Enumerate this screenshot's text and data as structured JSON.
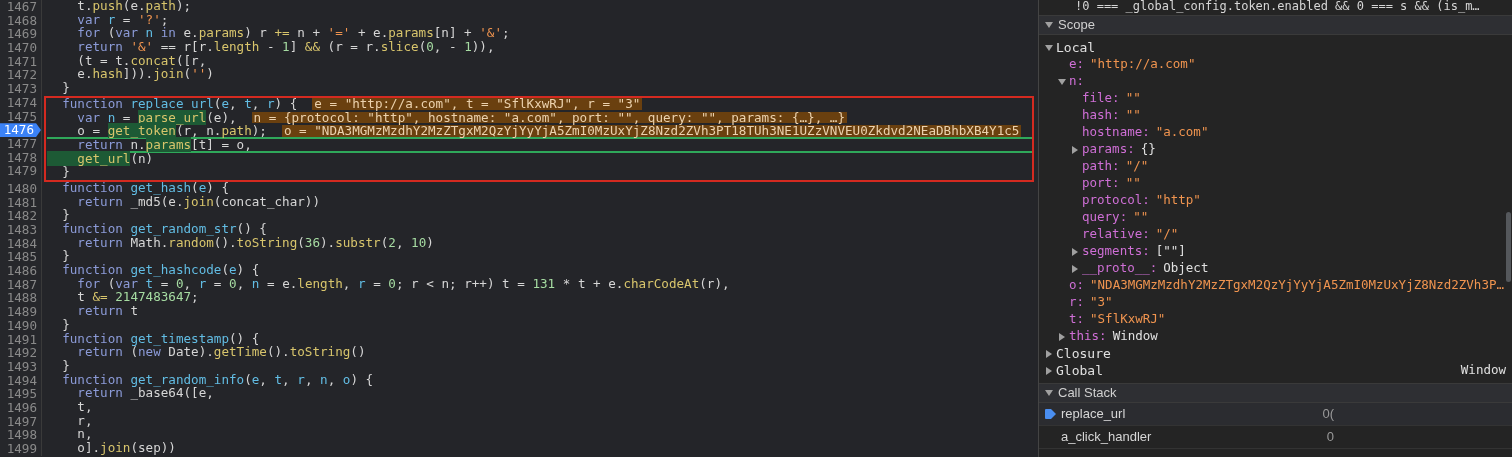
{
  "code": {
    "lines": [
      {
        "number": "1467",
        "current": false,
        "boxed": false,
        "underlined": false,
        "tokens": [
          {
            "text": "    t.",
            "kind": "plain"
          },
          {
            "text": "push",
            "kind": "prop"
          },
          {
            "text": "(e.",
            "kind": "plain"
          },
          {
            "text": "path",
            "kind": "prop"
          },
          {
            "text": ");",
            "kind": "plain"
          }
        ]
      },
      {
        "number": "1468",
        "current": false,
        "boxed": false,
        "underlined": false,
        "tokens": [
          {
            "text": "    var",
            "kind": "kw"
          },
          {
            "text": " r",
            "kind": "id"
          },
          {
            "text": " = ",
            "kind": "plain"
          },
          {
            "text": "'?'",
            "kind": "str"
          },
          {
            "text": ";",
            "kind": "plain"
          }
        ]
      },
      {
        "number": "1469",
        "current": false,
        "boxed": false,
        "underlined": false,
        "tokens": [
          {
            "text": "    for",
            "kind": "kw"
          },
          {
            "text": " (",
            "kind": "plain"
          },
          {
            "text": "var",
            "kind": "kw"
          },
          {
            "text": " n ",
            "kind": "id"
          },
          {
            "text": "in",
            "kind": "kw"
          },
          {
            "text": " e.",
            "kind": "plain"
          },
          {
            "text": "params",
            "kind": "prop"
          },
          {
            "text": ") r ",
            "kind": "plain"
          },
          {
            "text": "+=",
            "kind": "prop"
          },
          {
            "text": " n + ",
            "kind": "plain"
          },
          {
            "text": "'='",
            "kind": "str"
          },
          {
            "text": " + e.",
            "kind": "plain"
          },
          {
            "text": "params",
            "kind": "prop"
          },
          {
            "text": "[n] + ",
            "kind": "plain"
          },
          {
            "text": "'&'",
            "kind": "str"
          },
          {
            "text": ";",
            "kind": "plain"
          }
        ]
      },
      {
        "number": "1470",
        "current": false,
        "boxed": false,
        "underlined": false,
        "tokens": [
          {
            "text": "    return",
            "kind": "kw"
          },
          {
            "text": " '&'",
            "kind": "str"
          },
          {
            "text": " == r[r.",
            "kind": "plain"
          },
          {
            "text": "length",
            "kind": "prop"
          },
          {
            "text": " - ",
            "kind": "plain"
          },
          {
            "text": "1",
            "kind": "num"
          },
          {
            "text": "] ",
            "kind": "plain"
          },
          {
            "text": "&&",
            "kind": "prop"
          },
          {
            "text": " (r = r.",
            "kind": "plain"
          },
          {
            "text": "slice",
            "kind": "prop"
          },
          {
            "text": "(",
            "kind": "plain"
          },
          {
            "text": "0",
            "kind": "num"
          },
          {
            "text": ", - ",
            "kind": "plain"
          },
          {
            "text": "1",
            "kind": "num"
          },
          {
            "text": ")),",
            "kind": "plain"
          }
        ]
      },
      {
        "number": "1471",
        "current": false,
        "boxed": false,
        "underlined": false,
        "tokens": [
          {
            "text": "    (t = t.",
            "kind": "plain"
          },
          {
            "text": "concat",
            "kind": "prop"
          },
          {
            "text": "([r,",
            "kind": "plain"
          }
        ]
      },
      {
        "number": "1472",
        "current": false,
        "boxed": false,
        "underlined": false,
        "tokens": [
          {
            "text": "    e.",
            "kind": "plain"
          },
          {
            "text": "hash",
            "kind": "prop"
          },
          {
            "text": "])).",
            "kind": "plain"
          },
          {
            "text": "join",
            "kind": "prop"
          },
          {
            "text": "(",
            "kind": "plain"
          },
          {
            "text": "''",
            "kind": "str"
          },
          {
            "text": ")",
            "kind": "plain"
          }
        ]
      },
      {
        "number": "1473",
        "current": false,
        "boxed": false,
        "underlined": false,
        "tokens": [
          {
            "text": "  }",
            "kind": "plain"
          }
        ]
      },
      {
        "number": "1474",
        "current": false,
        "boxed": true,
        "underlined": false,
        "inline_value": "e = \"http://a.com\", t = \"SflKxwRJ\", r = \"3\"",
        "tokens": [
          {
            "text": "  function",
            "kind": "kw"
          },
          {
            "text": " replace_url",
            "kind": "fn"
          },
          {
            "text": "(",
            "kind": "plain"
          },
          {
            "text": "e",
            "kind": "id"
          },
          {
            "text": ", ",
            "kind": "plain"
          },
          {
            "text": "t",
            "kind": "id"
          },
          {
            "text": ", ",
            "kind": "plain"
          },
          {
            "text": "r",
            "kind": "id"
          },
          {
            "text": ") {",
            "kind": "plain"
          }
        ]
      },
      {
        "number": "1475",
        "current": false,
        "boxed": true,
        "underlined": false,
        "inline_value": "n = {protocol: \"http\", hostname: \"a.com\", port: \"\", query: \"\", params: {…}, …}",
        "tokens": [
          {
            "text": "    var",
            "kind": "kw"
          },
          {
            "text": " n",
            "kind": "id"
          },
          {
            "text": " = ",
            "kind": "plain"
          },
          {
            "text": "parse_url",
            "kind": "hl"
          },
          {
            "text": "(e),",
            "kind": "plain"
          }
        ]
      },
      {
        "number": "1476",
        "current": true,
        "boxed": true,
        "underlined": true,
        "inline_value": "o = \"NDA3MGMzMzdhY2MzZTgxM2QzYjYyYjA5ZmI0MzUxYjZ8Nzd2ZVh3PT18TUh3NE1UZzVNVEU0Zkdvd2NEaDBhbXB4Y1c5",
        "tokens": [
          {
            "text": "    o = ",
            "kind": "plain"
          },
          {
            "text": "get_token",
            "kind": "hl"
          },
          {
            "text": "(r, n.",
            "kind": "plain"
          },
          {
            "text": "path",
            "kind": "prop"
          },
          {
            "text": ");",
            "kind": "plain"
          }
        ]
      },
      {
        "number": "1477",
        "current": false,
        "boxed": true,
        "underlined": true,
        "tokens": [
          {
            "text": "    return",
            "kind": "kw"
          },
          {
            "text": " n.",
            "kind": "plain"
          },
          {
            "text": "params",
            "kind": "hl"
          },
          {
            "text": "[t] = o,",
            "kind": "plain"
          }
        ]
      },
      {
        "number": "1478",
        "current": false,
        "boxed": true,
        "underlined": false,
        "tokens": [
          {
            "text": "    get_url",
            "kind": "hl"
          },
          {
            "text": "(n)",
            "kind": "plain"
          }
        ]
      },
      {
        "number": "1479",
        "current": false,
        "boxed": true,
        "underlined": false,
        "tokens": [
          {
            "text": "  }",
            "kind": "plain"
          }
        ]
      },
      {
        "number": "1480",
        "current": false,
        "boxed": false,
        "underlined": false,
        "tokens": [
          {
            "text": "  function",
            "kind": "kw"
          },
          {
            "text": " get_hash",
            "kind": "fn"
          },
          {
            "text": "(",
            "kind": "plain"
          },
          {
            "text": "e",
            "kind": "id"
          },
          {
            "text": ") {",
            "kind": "plain"
          }
        ]
      },
      {
        "number": "1481",
        "current": false,
        "boxed": false,
        "underlined": false,
        "tokens": [
          {
            "text": "    return",
            "kind": "kw"
          },
          {
            "text": " _md5(e.",
            "kind": "plain"
          },
          {
            "text": "join",
            "kind": "prop"
          },
          {
            "text": "(concat_char))",
            "kind": "plain"
          }
        ]
      },
      {
        "number": "1482",
        "current": false,
        "boxed": false,
        "underlined": false,
        "tokens": [
          {
            "text": "  }",
            "kind": "plain"
          }
        ]
      },
      {
        "number": "1483",
        "current": false,
        "boxed": false,
        "underlined": false,
        "tokens": [
          {
            "text": "  function",
            "kind": "kw"
          },
          {
            "text": " get_random_str",
            "kind": "fn"
          },
          {
            "text": "() {",
            "kind": "plain"
          }
        ]
      },
      {
        "number": "1484",
        "current": false,
        "boxed": false,
        "underlined": false,
        "tokens": [
          {
            "text": "    return",
            "kind": "kw"
          },
          {
            "text": " Math.",
            "kind": "plain"
          },
          {
            "text": "random",
            "kind": "prop"
          },
          {
            "text": "().",
            "kind": "plain"
          },
          {
            "text": "toString",
            "kind": "prop"
          },
          {
            "text": "(",
            "kind": "plain"
          },
          {
            "text": "36",
            "kind": "num"
          },
          {
            "text": ").",
            "kind": "plain"
          },
          {
            "text": "substr",
            "kind": "prop"
          },
          {
            "text": "(",
            "kind": "plain"
          },
          {
            "text": "2",
            "kind": "num"
          },
          {
            "text": ", ",
            "kind": "plain"
          },
          {
            "text": "10",
            "kind": "num"
          },
          {
            "text": ")",
            "kind": "plain"
          }
        ]
      },
      {
        "number": "1485",
        "current": false,
        "boxed": false,
        "underlined": false,
        "tokens": [
          {
            "text": "  }",
            "kind": "plain"
          }
        ]
      },
      {
        "number": "1486",
        "current": false,
        "boxed": false,
        "underlined": false,
        "tokens": [
          {
            "text": "  function",
            "kind": "kw"
          },
          {
            "text": " get_hashcode",
            "kind": "fn"
          },
          {
            "text": "(",
            "kind": "plain"
          },
          {
            "text": "e",
            "kind": "id"
          },
          {
            "text": ") {",
            "kind": "plain"
          }
        ]
      },
      {
        "number": "1487",
        "current": false,
        "boxed": false,
        "underlined": false,
        "tokens": [
          {
            "text": "    for",
            "kind": "kw"
          },
          {
            "text": " (",
            "kind": "plain"
          },
          {
            "text": "var",
            "kind": "kw"
          },
          {
            "text": " t",
            "kind": "id"
          },
          {
            "text": " = ",
            "kind": "plain"
          },
          {
            "text": "0",
            "kind": "num"
          },
          {
            "text": ", ",
            "kind": "plain"
          },
          {
            "text": "r",
            "kind": "id"
          },
          {
            "text": " = ",
            "kind": "plain"
          },
          {
            "text": "0",
            "kind": "num"
          },
          {
            "text": ", ",
            "kind": "plain"
          },
          {
            "text": "n",
            "kind": "id"
          },
          {
            "text": " = e.",
            "kind": "plain"
          },
          {
            "text": "length",
            "kind": "prop"
          },
          {
            "text": ", ",
            "kind": "plain"
          },
          {
            "text": "r",
            "kind": "id"
          },
          {
            "text": " = ",
            "kind": "plain"
          },
          {
            "text": "0",
            "kind": "num"
          },
          {
            "text": "; r < n; r++) t = ",
            "kind": "plain"
          },
          {
            "text": "131",
            "kind": "num"
          },
          {
            "text": " * t + e.",
            "kind": "plain"
          },
          {
            "text": "charCodeAt",
            "kind": "prop"
          },
          {
            "text": "(r),",
            "kind": "plain"
          }
        ]
      },
      {
        "number": "1488",
        "current": false,
        "boxed": false,
        "underlined": false,
        "tokens": [
          {
            "text": "    t ",
            "kind": "plain"
          },
          {
            "text": "&=",
            "kind": "prop"
          },
          {
            "text": " 2147483647",
            "kind": "num"
          },
          {
            "text": ";",
            "kind": "plain"
          }
        ]
      },
      {
        "number": "1489",
        "current": false,
        "boxed": false,
        "underlined": false,
        "tokens": [
          {
            "text": "    return",
            "kind": "kw"
          },
          {
            "text": " t",
            "kind": "plain"
          }
        ]
      },
      {
        "number": "1490",
        "current": false,
        "boxed": false,
        "underlined": false,
        "tokens": [
          {
            "text": "  }",
            "kind": "plain"
          }
        ]
      },
      {
        "number": "1491",
        "current": false,
        "boxed": false,
        "underlined": false,
        "tokens": [
          {
            "text": "  function",
            "kind": "kw"
          },
          {
            "text": " get_timestamp",
            "kind": "fn"
          },
          {
            "text": "() {",
            "kind": "plain"
          }
        ]
      },
      {
        "number": "1492",
        "current": false,
        "boxed": false,
        "underlined": false,
        "tokens": [
          {
            "text": "    return",
            "kind": "kw"
          },
          {
            "text": " (",
            "kind": "plain"
          },
          {
            "text": "new",
            "kind": "kw"
          },
          {
            "text": " Date).",
            "kind": "plain"
          },
          {
            "text": "getTime",
            "kind": "prop"
          },
          {
            "text": "().",
            "kind": "plain"
          },
          {
            "text": "toString",
            "kind": "prop"
          },
          {
            "text": "()",
            "kind": "plain"
          }
        ]
      },
      {
        "number": "1493",
        "current": false,
        "boxed": false,
        "underlined": false,
        "tokens": [
          {
            "text": "  }",
            "kind": "plain"
          }
        ]
      },
      {
        "number": "1494",
        "current": false,
        "boxed": false,
        "underlined": false,
        "tokens": [
          {
            "text": "  function",
            "kind": "kw"
          },
          {
            "text": " get_random_info",
            "kind": "fn"
          },
          {
            "text": "(",
            "kind": "plain"
          },
          {
            "text": "e",
            "kind": "id"
          },
          {
            "text": ", ",
            "kind": "plain"
          },
          {
            "text": "t",
            "kind": "id"
          },
          {
            "text": ", ",
            "kind": "plain"
          },
          {
            "text": "r",
            "kind": "id"
          },
          {
            "text": ", ",
            "kind": "plain"
          },
          {
            "text": "n",
            "kind": "id"
          },
          {
            "text": ", ",
            "kind": "plain"
          },
          {
            "text": "o",
            "kind": "id"
          },
          {
            "text": ") {",
            "kind": "plain"
          }
        ]
      },
      {
        "number": "1495",
        "current": false,
        "boxed": false,
        "underlined": false,
        "tokens": [
          {
            "text": "    return",
            "kind": "kw"
          },
          {
            "text": " _base64([e,",
            "kind": "plain"
          }
        ]
      },
      {
        "number": "1496",
        "current": false,
        "boxed": false,
        "underlined": false,
        "tokens": [
          {
            "text": "    t,",
            "kind": "plain"
          }
        ]
      },
      {
        "number": "1497",
        "current": false,
        "boxed": false,
        "underlined": false,
        "tokens": [
          {
            "text": "    r,",
            "kind": "plain"
          }
        ]
      },
      {
        "number": "1498",
        "current": false,
        "boxed": false,
        "underlined": false,
        "tokens": [
          {
            "text": "    n,",
            "kind": "plain"
          }
        ]
      },
      {
        "number": "1499",
        "current": false,
        "boxed": false,
        "underlined": false,
        "tokens": [
          {
            "text": "    o].",
            "kind": "plain"
          },
          {
            "text": "join",
            "kind": "prop"
          },
          {
            "text": "(sep))",
            "kind": "plain"
          }
        ]
      }
    ]
  },
  "debugger": {
    "watch_line": "!0 === _global_config.token.enabled && 0 === s && (is_m…",
    "scope": {
      "title": "Scope",
      "expanded": true,
      "items": [
        {
          "kind": "scope",
          "name": "Local",
          "expanded": true,
          "children": [
            {
              "kind": "property",
              "name": "e:",
              "value": "\"http://a.com\"",
              "string": true
            },
            {
              "kind": "property",
              "name": "n:",
              "expanded": true,
              "children": [
                {
                  "kind": "property",
                  "name": "file:",
                  "value": "\"\"",
                  "string": true
                },
                {
                  "kind": "property",
                  "name": "hash:",
                  "value": "\"\"",
                  "string": true
                },
                {
                  "kind": "property",
                  "name": "hostname:",
                  "value": "\"a.com\"",
                  "string": true
                },
                {
                  "kind": "property",
                  "name": "params:",
                  "value": "{}",
                  "string": false,
                  "expanded": false
                },
                {
                  "kind": "property",
                  "name": "path:",
                  "value": "\"/\"",
                  "string": true
                },
                {
                  "kind": "property",
                  "name": "port:",
                  "value": "\"\"",
                  "string": true
                },
                {
                  "kind": "property",
                  "name": "protocol:",
                  "value": "\"http\"",
                  "string": true
                },
                {
                  "kind": "property",
                  "name": "query:",
                  "value": "\"\"",
                  "string": true
                },
                {
                  "kind": "property",
                  "name": "relative:",
                  "value": "\"/\"",
                  "string": true
                },
                {
                  "kind": "property",
                  "name": "segments:",
                  "value": "[\"\"]",
                  "string": false,
                  "expanded": false
                },
                {
                  "kind": "property",
                  "name": "__proto__:",
                  "value": "Object",
                  "string": false,
                  "expanded": false
                }
              ]
            },
            {
              "kind": "property",
              "name": "o:",
              "value": "\"NDA3MGMzMzdhY2MzZTgxM2QzYjYyYjA5ZmI0MzUxYjZ8Nzd2ZVh3P…",
              "string": true
            },
            {
              "kind": "property",
              "name": "r:",
              "value": "\"3\"",
              "string": true
            },
            {
              "kind": "property",
              "name": "t:",
              "value": "\"SflKxwRJ\"",
              "string": true
            },
            {
              "kind": "property",
              "name": "this:",
              "value": "Window",
              "string": false,
              "expanded": false
            }
          ]
        },
        {
          "kind": "scope",
          "name": "Closure",
          "expanded": false
        },
        {
          "kind": "scope",
          "name": "Global",
          "value": "Window",
          "string": false,
          "expanded": false
        }
      ]
    },
    "call_stack": {
      "title": "Call Stack",
      "expanded": true,
      "frames": [
        {
          "name": "replace_url",
          "location": "0(",
          "selected": true
        },
        {
          "name": "a_click_handler",
          "location": "0",
          "selected": false
        }
      ]
    }
  }
}
